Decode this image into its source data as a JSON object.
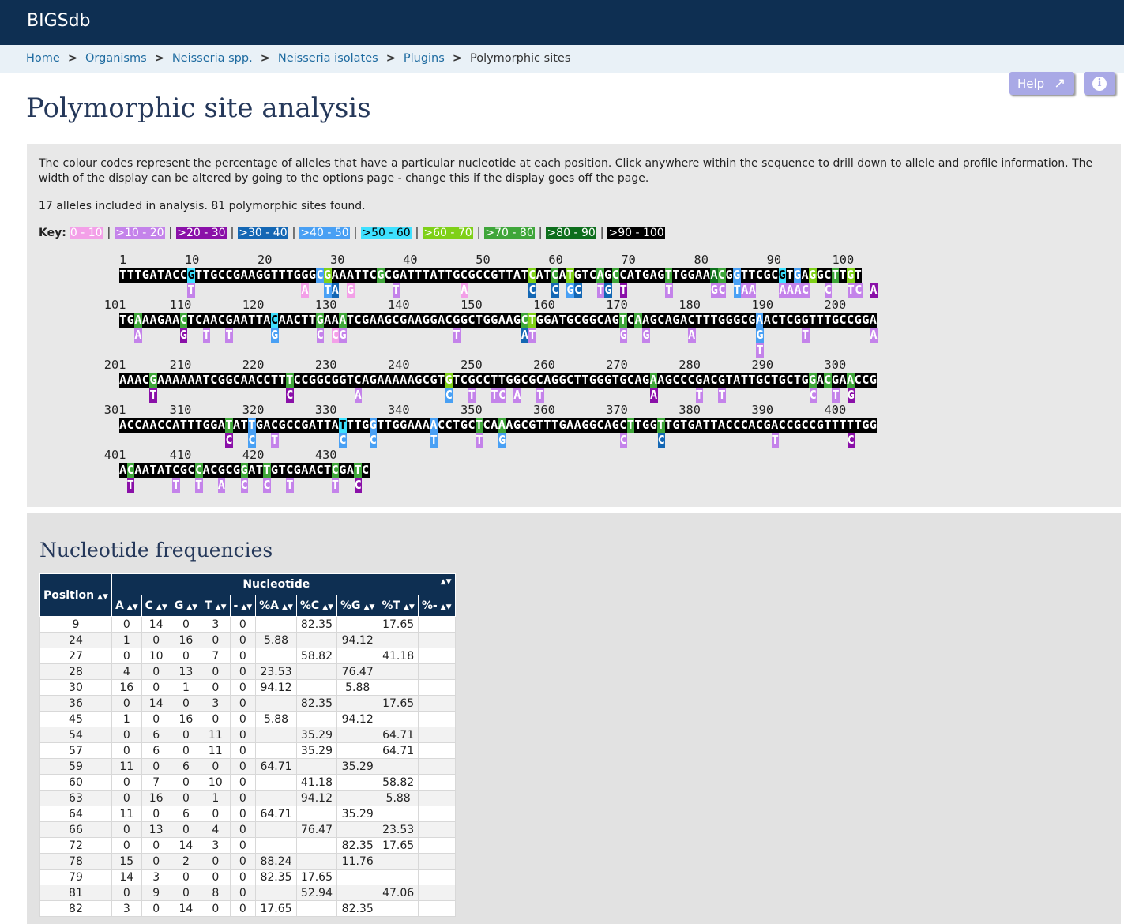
{
  "app_title": "BIGSdb",
  "breadcrumb": [
    "Home",
    "Organisms",
    "Neisseria spp.",
    "Neisseria isolates",
    "Plugins",
    "Polymorphic sites"
  ],
  "page_title": "Polymorphic site analysis",
  "help_label": "Help",
  "intro_text": "The colour codes represent the percentage of alleles that have a particular nucleotide at each position. Click anywhere within the sequence to drill down to allele and profile information. The width of the display can be altered by going to the options page - change this if the display goes off the page.",
  "summary_text": "17 alleles included in analysis. 81 polymorphic sites found.",
  "key_label": "Key:",
  "key": [
    {
      "label": "0 - 10",
      "bg": "#f3a0e8",
      "fg": "#ffffff"
    },
    {
      "label": ">10 - 20",
      "bg": "#c483ea",
      "fg": "#ffffff"
    },
    {
      "label": ">20 - 30",
      "bg": "#8a10a8",
      "fg": "#ffffff"
    },
    {
      "label": ">30 - 40",
      "bg": "#1467b4",
      "fg": "#ffffff"
    },
    {
      "label": ">40 - 50",
      "bg": "#49a0f4",
      "fg": "#ffffff"
    },
    {
      "label": ">50 - 60",
      "bg": "#3ee0ff",
      "fg": "#000000"
    },
    {
      "label": ">60 - 70",
      "bg": "#7fd018",
      "fg": "#ffffff"
    },
    {
      "label": ">70 - 80",
      "bg": "#3fa63a",
      "fg": "#ffffff"
    },
    {
      "label": ">80 - 90",
      "bg": "#0d6e1c",
      "fg": "#ffffff"
    },
    {
      "label": ">90 - 100",
      "bg": "#000000",
      "fg": "#ffffff"
    }
  ],
  "key_separator": "|",
  "sequence_blocks": [
    {
      "start": "1",
      "ruler": "1        10        20        30        40        50        60        70        80        90       100",
      "seq": "TTTGATACCGTTGCCGAAGGTTTGGGCGAAATTCGCGATTTATTGCGCCGTTATCATCATGTCAGCCATGAGTTGGAAACGGTTCGCGTGAGGCTTGT",
      "hl": {
        "9": 5,
        "26": 4,
        "27": 6,
        "34": 7,
        "54": 6,
        "57": 7,
        "59": 6,
        "63": 7,
        "65": 7,
        "72": 7,
        "78": 8,
        "79": 7,
        "81": 4,
        "87": 5,
        "89": 4,
        "91": 6,
        "94": 7,
        "96": 6,
        "99": 7
      },
      "vars": [
        {
          "row": 0,
          "pos": 9,
          "ch": "T",
          "lvl": 1
        },
        {
          "row": 0,
          "pos": 24,
          "ch": "A",
          "lvl": 0
        },
        {
          "row": 0,
          "pos": 27,
          "ch": "T",
          "lvl": 4
        },
        {
          "row": 0,
          "pos": 28,
          "ch": "A",
          "lvl": 3
        },
        {
          "row": 0,
          "pos": 30,
          "ch": "G",
          "lvl": 0
        },
        {
          "row": 0,
          "pos": 36,
          "ch": "T",
          "lvl": 1
        },
        {
          "row": 0,
          "pos": 45,
          "ch": "A",
          "lvl": 0
        },
        {
          "row": 0,
          "pos": 54,
          "ch": "C",
          "lvl": 3
        },
        {
          "row": 0,
          "pos": 57,
          "ch": "C",
          "lvl": 3
        },
        {
          "row": 0,
          "pos": 59,
          "ch": "G",
          "lvl": 4
        },
        {
          "row": 0,
          "pos": 60,
          "ch": "C",
          "lvl": 3
        },
        {
          "row": 0,
          "pos": 63,
          "ch": "T",
          "lvl": 1
        },
        {
          "row": 0,
          "pos": 64,
          "ch": "G",
          "lvl": 3
        },
        {
          "row": 0,
          "pos": 66,
          "ch": "T",
          "lvl": 2
        },
        {
          "row": 0,
          "pos": 72,
          "ch": "T",
          "lvl": 1
        },
        {
          "row": 0,
          "pos": 78,
          "ch": "G",
          "lvl": 1
        },
        {
          "row": 0,
          "pos": 79,
          "ch": "C",
          "lvl": 1
        },
        {
          "row": 0,
          "pos": 81,
          "ch": "T",
          "lvl": 4
        },
        {
          "row": 0,
          "pos": 82,
          "ch": "A",
          "lvl": 1
        },
        {
          "row": 0,
          "pos": 83,
          "ch": "A",
          "lvl": 1
        },
        {
          "row": 0,
          "pos": 87,
          "ch": "A",
          "lvl": 1
        },
        {
          "row": 0,
          "pos": 88,
          "ch": "A",
          "lvl": 1
        },
        {
          "row": 0,
          "pos": 89,
          "ch": "A",
          "lvl": 1
        },
        {
          "row": 0,
          "pos": 90,
          "ch": "C",
          "lvl": 1
        },
        {
          "row": 0,
          "pos": 93,
          "ch": "C",
          "lvl": 1
        },
        {
          "row": 0,
          "pos": 96,
          "ch": "T",
          "lvl": 1
        },
        {
          "row": 0,
          "pos": 97,
          "ch": "C",
          "lvl": 1
        },
        {
          "row": 0,
          "pos": 99,
          "ch": "A",
          "lvl": 2
        }
      ]
    },
    {
      "start": "101",
      "ruler": "101      110       120       130       140       150       160       170       180       190       200",
      "seq": "TGAAAGAACTCAACGAATTACAACTTGAAATCGAAGCGAAGGACGGCTGGAAGCTGGATGCGGCAGTCAAGCAGACTTTGGGCGAACTCGGTTTGCCGGA",
      "hl": {
        "2": 7,
        "8": 7,
        "20": 5,
        "26": 7,
        "29": 7,
        "53": 7,
        "54": 6,
        "66": 7,
        "68": 7,
        "84": 4
      },
      "vars": [
        {
          "row": 0,
          "pos": 2,
          "ch": "A",
          "lvl": 1
        },
        {
          "row": 0,
          "pos": 8,
          "ch": "G",
          "lvl": 2
        },
        {
          "row": 0,
          "pos": 11,
          "ch": "T",
          "lvl": 1
        },
        {
          "row": 0,
          "pos": 14,
          "ch": "T",
          "lvl": 1
        },
        {
          "row": 0,
          "pos": 20,
          "ch": "G",
          "lvl": 4
        },
        {
          "row": 0,
          "pos": 26,
          "ch": "C",
          "lvl": 1
        },
        {
          "row": 0,
          "pos": 28,
          "ch": "C",
          "lvl": 0
        },
        {
          "row": 0,
          "pos": 29,
          "ch": "G",
          "lvl": 1
        },
        {
          "row": 0,
          "pos": 44,
          "ch": "T",
          "lvl": 1
        },
        {
          "row": 0,
          "pos": 53,
          "ch": "A",
          "lvl": 3
        },
        {
          "row": 0,
          "pos": 54,
          "ch": "T",
          "lvl": 1
        },
        {
          "row": 0,
          "pos": 66,
          "ch": "G",
          "lvl": 1
        },
        {
          "row": 0,
          "pos": 69,
          "ch": "G",
          "lvl": 1
        },
        {
          "row": 0,
          "pos": 75,
          "ch": "A",
          "lvl": 1
        },
        {
          "row": 0,
          "pos": 84,
          "ch": "G",
          "lvl": 4
        },
        {
          "row": 1,
          "pos": 84,
          "ch": "T",
          "lvl": 1
        },
        {
          "row": 0,
          "pos": 90,
          "ch": "T",
          "lvl": 1
        },
        {
          "row": 0,
          "pos": 99,
          "ch": "A",
          "lvl": 1
        }
      ]
    },
    {
      "start": "201",
      "ruler": "201      210       220       230       240       250       260       270       280       290       300",
      "seq": "AAACGAAAAAATCGGCAACCTTTCCGGCGGTCAGAAAAAGCGTGTCGCCTTGGCGCAGGCTTGGGTGCAGAAGCCCGACGTATTGCTGCTGGACGAACCG",
      "hl": {
        "4": 7,
        "22": 7,
        "43": 6,
        "70": 7,
        "91": 7,
        "93": 7,
        "96": 7
      },
      "vars": [
        {
          "row": 0,
          "pos": 4,
          "ch": "T",
          "lvl": 2
        },
        {
          "row": 0,
          "pos": 22,
          "ch": "C",
          "lvl": 2
        },
        {
          "row": 0,
          "pos": 31,
          "ch": "A",
          "lvl": 1
        },
        {
          "row": 0,
          "pos": 43,
          "ch": "C",
          "lvl": 4
        },
        {
          "row": 0,
          "pos": 46,
          "ch": "T",
          "lvl": 1
        },
        {
          "row": 0,
          "pos": 49,
          "ch": "T",
          "lvl": 1
        },
        {
          "row": 0,
          "pos": 50,
          "ch": "C",
          "lvl": 1
        },
        {
          "row": 0,
          "pos": 52,
          "ch": "A",
          "lvl": 1
        },
        {
          "row": 0,
          "pos": 55,
          "ch": "T",
          "lvl": 1
        },
        {
          "row": 0,
          "pos": 70,
          "ch": "A",
          "lvl": 2
        },
        {
          "row": 0,
          "pos": 76,
          "ch": "T",
          "lvl": 1
        },
        {
          "row": 0,
          "pos": 79,
          "ch": "T",
          "lvl": 1
        },
        {
          "row": 0,
          "pos": 91,
          "ch": "C",
          "lvl": 1
        },
        {
          "row": 0,
          "pos": 94,
          "ch": "T",
          "lvl": 1
        },
        {
          "row": 0,
          "pos": 96,
          "ch": "G",
          "lvl": 2
        }
      ]
    },
    {
      "start": "301",
      "ruler": "301      310       320       330       340       350       360       370       380       390       400",
      "seq": "ACCAACCATTTGGATATTGACGCCGATTATTTGGTTGGAAAACCTGCTCAAAGCGTTTGAAGGCAGCTTGGTTGTGATTACCCACGACCGCCGTTTTTGG",
      "hl": {
        "14": 7,
        "17": 4,
        "29": 5,
        "33": 4,
        "41": 4,
        "47": 7,
        "50": 7,
        "67": 7,
        "71": 7
      },
      "vars": [
        {
          "row": 0,
          "pos": 14,
          "ch": "C",
          "lvl": 2
        },
        {
          "row": 0,
          "pos": 17,
          "ch": "C",
          "lvl": 4
        },
        {
          "row": 0,
          "pos": 20,
          "ch": "T",
          "lvl": 1
        },
        {
          "row": 0,
          "pos": 29,
          "ch": "C",
          "lvl": 4
        },
        {
          "row": 0,
          "pos": 33,
          "ch": "C",
          "lvl": 4
        },
        {
          "row": 0,
          "pos": 41,
          "ch": "T",
          "lvl": 4
        },
        {
          "row": 0,
          "pos": 47,
          "ch": "T",
          "lvl": 1
        },
        {
          "row": 0,
          "pos": 50,
          "ch": "G",
          "lvl": 4
        },
        {
          "row": 0,
          "pos": 66,
          "ch": "C",
          "lvl": 1
        },
        {
          "row": 0,
          "pos": 71,
          "ch": "C",
          "lvl": 3
        },
        {
          "row": 0,
          "pos": 86,
          "ch": "T",
          "lvl": 1
        },
        {
          "row": 0,
          "pos": 96,
          "ch": "C",
          "lvl": 2
        }
      ]
    },
    {
      "start": "401",
      "ruler": "401      410       420       430",
      "seq": "ACAATATCGCCACGCGGATTGTCGAACTCGATC",
      "hl": {
        "1": 7,
        "10": 7,
        "16": 7,
        "19": 7,
        "28": 7,
        "31": 7
      },
      "vars": [
        {
          "row": 0,
          "pos": 1,
          "ch": "T",
          "lvl": 2
        },
        {
          "row": 0,
          "pos": 7,
          "ch": "T",
          "lvl": 1
        },
        {
          "row": 0,
          "pos": 10,
          "ch": "T",
          "lvl": 1
        },
        {
          "row": 0,
          "pos": 13,
          "ch": "A",
          "lvl": 1
        },
        {
          "row": 0,
          "pos": 16,
          "ch": "C",
          "lvl": 1
        },
        {
          "row": 0,
          "pos": 19,
          "ch": "C",
          "lvl": 1
        },
        {
          "row": 0,
          "pos": 22,
          "ch": "T",
          "lvl": 1
        },
        {
          "row": 0,
          "pos": 28,
          "ch": "T",
          "lvl": 1
        },
        {
          "row": 0,
          "pos": 31,
          "ch": "C",
          "lvl": 2
        }
      ]
    }
  ],
  "freq_title": "Nucleotide frequencies",
  "freq_headers": {
    "position": "Position",
    "nucleotide": "Nucleotide",
    "cols": [
      "A",
      "C",
      "G",
      "T",
      "-",
      "%A",
      "%C",
      "%G",
      "%T",
      "%-"
    ]
  },
  "freq_rows": [
    [
      "9",
      "0",
      "14",
      "0",
      "3",
      "0",
      "",
      "82.35",
      "",
      "17.65",
      ""
    ],
    [
      "24",
      "1",
      "0",
      "16",
      "0",
      "0",
      "5.88",
      "",
      "94.12",
      "",
      ""
    ],
    [
      "27",
      "0",
      "10",
      "0",
      "7",
      "0",
      "",
      "58.82",
      "",
      "41.18",
      ""
    ],
    [
      "28",
      "4",
      "0",
      "13",
      "0",
      "0",
      "23.53",
      "",
      "76.47",
      "",
      ""
    ],
    [
      "30",
      "16",
      "0",
      "1",
      "0",
      "0",
      "94.12",
      "",
      "5.88",
      "",
      ""
    ],
    [
      "36",
      "0",
      "14",
      "0",
      "3",
      "0",
      "",
      "82.35",
      "",
      "17.65",
      ""
    ],
    [
      "45",
      "1",
      "0",
      "16",
      "0",
      "0",
      "5.88",
      "",
      "94.12",
      "",
      ""
    ],
    [
      "54",
      "0",
      "6",
      "0",
      "11",
      "0",
      "",
      "35.29",
      "",
      "64.71",
      ""
    ],
    [
      "57",
      "0",
      "6",
      "0",
      "11",
      "0",
      "",
      "35.29",
      "",
      "64.71",
      ""
    ],
    [
      "59",
      "11",
      "0",
      "6",
      "0",
      "0",
      "64.71",
      "",
      "35.29",
      "",
      ""
    ],
    [
      "60",
      "0",
      "7",
      "0",
      "10",
      "0",
      "",
      "41.18",
      "",
      "58.82",
      ""
    ],
    [
      "63",
      "0",
      "16",
      "0",
      "1",
      "0",
      "",
      "94.12",
      "",
      "5.88",
      ""
    ],
    [
      "64",
      "11",
      "0",
      "6",
      "0",
      "0",
      "64.71",
      "",
      "35.29",
      "",
      ""
    ],
    [
      "66",
      "0",
      "13",
      "0",
      "4",
      "0",
      "",
      "76.47",
      "",
      "23.53",
      ""
    ],
    [
      "72",
      "0",
      "0",
      "14",
      "3",
      "0",
      "",
      "",
      "82.35",
      "17.65",
      ""
    ],
    [
      "78",
      "15",
      "0",
      "2",
      "0",
      "0",
      "88.24",
      "",
      "11.76",
      "",
      ""
    ],
    [
      "79",
      "14",
      "3",
      "0",
      "0",
      "0",
      "82.35",
      "17.65",
      "",
      "",
      ""
    ],
    [
      "81",
      "0",
      "9",
      "0",
      "8",
      "0",
      "",
      "52.94",
      "",
      "47.06",
      ""
    ],
    [
      "82",
      "3",
      "0",
      "14",
      "0",
      "0",
      "17.65",
      "",
      "82.35",
      "",
      ""
    ]
  ]
}
